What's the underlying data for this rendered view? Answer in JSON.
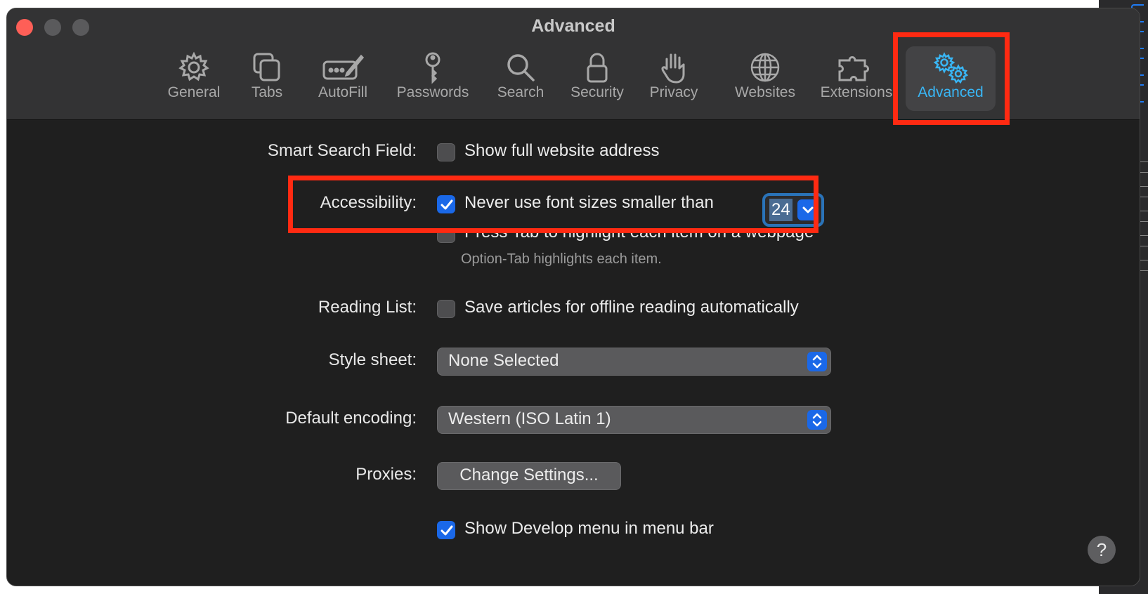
{
  "window": {
    "title": "Advanced"
  },
  "toolbar": {
    "items": [
      {
        "label": "General",
        "icon": "gear-icon"
      },
      {
        "label": "Tabs",
        "icon": "tabs-icon"
      },
      {
        "label": "AutoFill",
        "icon": "autofill-pencil-icon"
      },
      {
        "label": "Passwords",
        "icon": "key-icon"
      },
      {
        "label": "Search",
        "icon": "magnifier-icon"
      },
      {
        "label": "Security",
        "icon": "lock-icon"
      },
      {
        "label": "Privacy",
        "icon": "hand-icon"
      },
      {
        "label": "Websites",
        "icon": "globe-icon"
      },
      {
        "label": "Extensions",
        "icon": "puzzle-icon"
      },
      {
        "label": "Advanced",
        "icon": "double-gear-icon",
        "selected": true
      }
    ],
    "selected_color": "#39b6f5"
  },
  "settings": {
    "smart_search": {
      "label": "Smart Search Field:",
      "option": "Show full website address",
      "checked": false
    },
    "accessibility": {
      "label": "Accessibility:",
      "option": "Never use font sizes smaller than",
      "checked": true,
      "font_size": "24",
      "tab_option": "Press Tab to highlight each item on a webpage",
      "tab_checked": false,
      "tab_note": "Option-Tab highlights each item."
    },
    "reading_list": {
      "label": "Reading List:",
      "option": "Save articles for offline reading automatically",
      "checked": false
    },
    "style_sheet": {
      "label": "Style sheet:",
      "value": "None Selected"
    },
    "default_encoding": {
      "label": "Default encoding:",
      "value": "Western (ISO Latin 1)"
    },
    "proxies": {
      "label": "Proxies:",
      "button": "Change Settings..."
    },
    "develop_menu": {
      "option": "Show Develop menu in menu bar",
      "checked": true
    }
  },
  "help": {
    "label": "?"
  },
  "colors": {
    "highlight": "#ff2a12",
    "accent": "#1a68e8"
  }
}
